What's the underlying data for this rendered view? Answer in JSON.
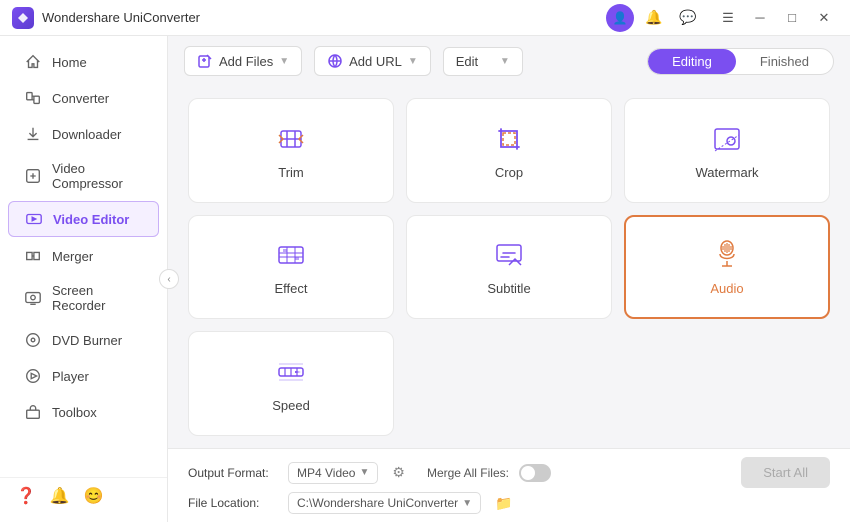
{
  "app": {
    "title": "Wondershare UniConverter",
    "logo_color": "#7b4ff0"
  },
  "titlebar": {
    "right_icons": [
      "user",
      "bell",
      "feedback"
    ],
    "controls": [
      "menu",
      "minimize",
      "maximize",
      "close"
    ]
  },
  "sidebar": {
    "items": [
      {
        "id": "home",
        "label": "Home",
        "icon": "home"
      },
      {
        "id": "converter",
        "label": "Converter",
        "icon": "converter"
      },
      {
        "id": "downloader",
        "label": "Downloader",
        "icon": "downloader"
      },
      {
        "id": "video-compressor",
        "label": "Video Compressor",
        "icon": "compress"
      },
      {
        "id": "video-editor",
        "label": "Video Editor",
        "icon": "video-editor",
        "active": true
      },
      {
        "id": "merger",
        "label": "Merger",
        "icon": "merge"
      },
      {
        "id": "screen-recorder",
        "label": "Screen Recorder",
        "icon": "screen-record"
      },
      {
        "id": "dvd-burner",
        "label": "DVD Burner",
        "icon": "dvd"
      },
      {
        "id": "player",
        "label": "Player",
        "icon": "player"
      },
      {
        "id": "toolbox",
        "label": "Toolbox",
        "icon": "toolbox"
      }
    ],
    "bottom_icons": [
      "help",
      "bell",
      "feedback"
    ]
  },
  "toolbar": {
    "add_file_label": "Add Files",
    "add_url_label": "Add URL",
    "edit_dropdown_label": "Edit",
    "tabs": [
      {
        "id": "editing",
        "label": "Editing",
        "active": true
      },
      {
        "id": "finished",
        "label": "Finished",
        "active": false
      }
    ]
  },
  "tools": [
    {
      "id": "trim",
      "label": "Trim",
      "icon": "trim",
      "active": false
    },
    {
      "id": "crop",
      "label": "Crop",
      "icon": "crop",
      "active": false
    },
    {
      "id": "watermark",
      "label": "Watermark",
      "icon": "watermark",
      "active": false
    },
    {
      "id": "effect",
      "label": "Effect",
      "icon": "effect",
      "active": false
    },
    {
      "id": "subtitle",
      "label": "Subtitle",
      "icon": "subtitle",
      "active": false
    },
    {
      "id": "audio",
      "label": "Audio",
      "icon": "audio",
      "active": true
    },
    {
      "id": "speed",
      "label": "Speed",
      "icon": "speed",
      "active": false
    }
  ],
  "bottom_bar": {
    "output_format_label": "Output Format:",
    "output_format_value": "MP4 Video",
    "file_location_label": "File Location:",
    "file_location_value": "C:\\Wondershare UniConverter",
    "merge_all_files_label": "Merge All Files:",
    "start_all_label": "Start All"
  }
}
